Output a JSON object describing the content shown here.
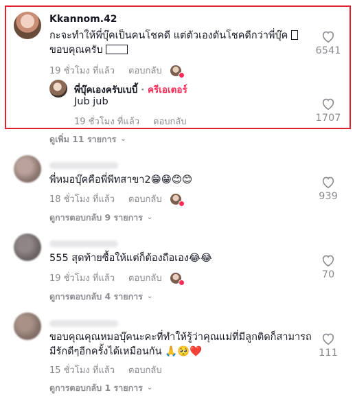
{
  "comments": [
    {
      "username": "Kkannom.42",
      "text_line1": "กะจะทำให้พี่บุ๊คเป็นคนโชคดี แต่ตัวเองดันโชคดีกว่าพี่บุ๊ค ",
      "text_line2": "ขอบคุณครับ ",
      "time": "19 ชั่วโมง ที่แล้ว",
      "reply_label": "ตอบกลับ",
      "likes": "6541",
      "reply": {
        "username": "พี่บุ๊คเองครับเบบี้",
        "separator": " · ",
        "creator_badge": "ครีเอเตอร์",
        "text": "Jub jub",
        "time": "19 ชั่วโมง ที่แล้ว",
        "reply_label": "ตอบกลับ",
        "likes": "1707"
      },
      "more_label": "ดูเพิ่ม 11 รายการ"
    },
    {
      "text": "พี่หมอบุ๊คคือพี่พีทสาขา2",
      "emojis": "😁😁😊😊",
      "time": "18 ชั่วโมง ที่แล้ว",
      "reply_label": "ตอบกลับ",
      "likes": "939",
      "more_label": "ดูการตอบกลับ 9 รายการ"
    },
    {
      "text": "555 สุดท้ายซื้อให้แต่ก็ต้องถือเอง",
      "emojis": "😂😂",
      "time": "19 ชั่วโมง ที่แล้ว",
      "reply_label": "ตอบกลับ",
      "likes": "70",
      "more_label": "ดูการตอบกลับ 4 รายการ"
    },
    {
      "text_line1": "ขอบคุณคุณหมอบุ๊คนะคะที่ทำให้รู้ว่าคุณแม่ที่มีลูกติดก็สามารถ",
      "text_line2": "มีรักดีๆอีกครั้งได้เหมือนกัน ",
      "emojis": "🙏🥺❤️",
      "time": "15 ชั่วโมง ที่แล้ว",
      "reply_label": "ตอบกลับ",
      "likes": "111",
      "more_label": "ดูการตอบกลับ 1 รายการ"
    }
  ],
  "icons": {
    "like": "heart-outline-icon",
    "expand": "chevron-down-icon",
    "creator_liked": "creator-liked-avatar"
  },
  "colors": {
    "highlight_border": "#e0202a",
    "creator": "#fe2c55",
    "meta_text": "#8a8b91"
  }
}
